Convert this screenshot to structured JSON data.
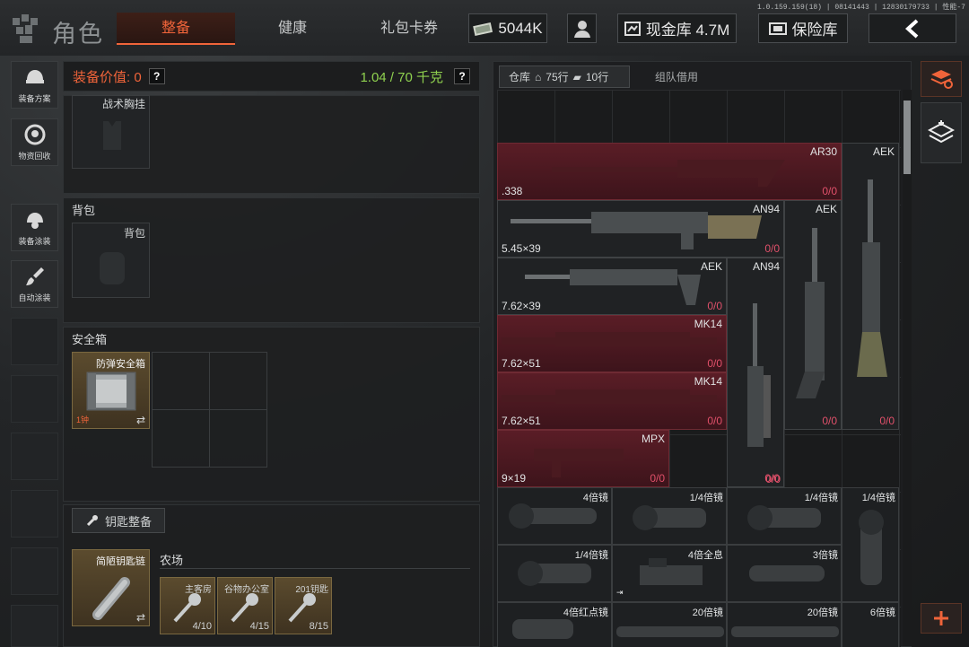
{
  "app": {
    "title": "角色",
    "version": "1.0.159.159(18) | 08141443 | 12830179733 | 性能-7"
  },
  "tabs": [
    {
      "label": "整备",
      "active": true
    },
    {
      "label": "健康",
      "active": false
    },
    {
      "label": "礼包卡券",
      "active": false
    }
  ],
  "currency": {
    "amount": "5044K",
    "cash_label": "现金库 4.7M",
    "vault_label": "保险库"
  },
  "sidebar": [
    {
      "label": "装备方案"
    },
    {
      "label": "物资回收"
    },
    {
      "label": "装备涂装"
    },
    {
      "label": "自动涂装"
    }
  ],
  "loadout": {
    "value_label": "装备价值: 0",
    "weight": "1.04 / 70 千克",
    "help": "?",
    "tactical_rig_label": "战术胸挂",
    "backpack_section": "背包",
    "backpack_slot": "背包",
    "safebox_section": "安全箱",
    "safebox_item": "防弹安全箱",
    "safebox_time": "1钟",
    "keys_button": "钥匙整备",
    "keychain_item": "简陋钥匙链",
    "location": "农场",
    "keys": [
      {
        "name": "主客房",
        "count": "4/10"
      },
      {
        "name": "谷物办公室",
        "count": "4/15"
      },
      {
        "name": "201钥匙",
        "count": "8/15"
      }
    ]
  },
  "storage": {
    "tab_warehouse": "仓库",
    "rows1": "75行",
    "rows2": "10行",
    "tab_team": "组队借用",
    "weapons": [
      {
        "name": "AR30",
        "caliber": ".338",
        "count": "0/0",
        "red": true
      },
      {
        "name": "AEK",
        "caliber": "",
        "count": "0/0",
        "red": false
      },
      {
        "name": "AN94",
        "caliber": "5.45×39",
        "count": "0/0",
        "red": false
      },
      {
        "name": "AEK",
        "caliber": "",
        "count": "0/0",
        "red": false
      },
      {
        "name": "AEK",
        "caliber": "7.62×39",
        "count": "0/0",
        "red": false
      },
      {
        "name": "AN94",
        "caliber": "",
        "count": "0/0",
        "red": false
      },
      {
        "name": "MK14",
        "caliber": "7.62×51",
        "count": "0/0",
        "red": true
      },
      {
        "name": "MK14",
        "caliber": "7.62×51",
        "count": "0/0",
        "red": true
      },
      {
        "name": "MPX",
        "caliber": "9×19",
        "count": "0/0",
        "red": true
      },
      {
        "name": "",
        "caliber": "",
        "count": "0/0",
        "red": false
      }
    ],
    "scopes": [
      {
        "name": "4倍镜"
      },
      {
        "name": "1/4倍镜"
      },
      {
        "name": "1/4倍镜"
      },
      {
        "name": "1/4倍镜"
      },
      {
        "name": "1/4倍镜"
      },
      {
        "name": "4倍全息"
      },
      {
        "name": "3倍镜"
      },
      {
        "name": "4倍红点镜"
      },
      {
        "name": "20倍镜"
      },
      {
        "name": "20倍镜"
      },
      {
        "name": "6倍镜"
      }
    ]
  },
  "icons": {
    "back": "chevron-left-icon",
    "add": "plus-icon",
    "accent": "#f0643a",
    "weight_color": "#8fd14f",
    "cost_color": "#e0506a"
  }
}
